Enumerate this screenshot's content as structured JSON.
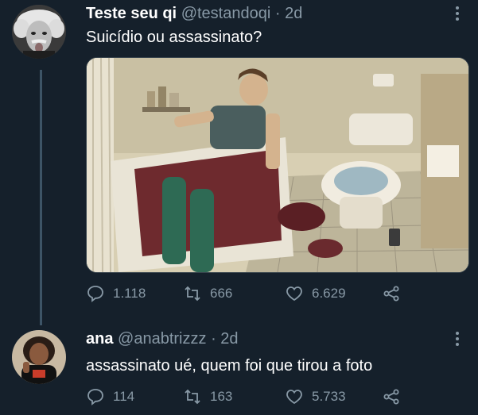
{
  "tweets": [
    {
      "name": "Teste seu qi",
      "handle": "@testandoqi",
      "separator": "·",
      "time": "2d",
      "text": "Suicídio ou assassinato?",
      "replies": "1.118",
      "retweets": "666",
      "likes": "6.629"
    },
    {
      "name": "ana",
      "handle": "@anabtrizzz",
      "separator": "·",
      "time": "2d",
      "text": "assassinato ué, quem foi que tirou a foto",
      "replies": "114",
      "retweets": "163",
      "likes": "5.733"
    }
  ],
  "icons": {
    "reply": "reply-icon",
    "retweet": "retweet-icon",
    "like": "heart-icon",
    "share": "share-icon",
    "more": "more-icon"
  },
  "colors": {
    "background": "#15202b",
    "secondary_text": "#8899a6",
    "thread_line": "#3d5466"
  }
}
